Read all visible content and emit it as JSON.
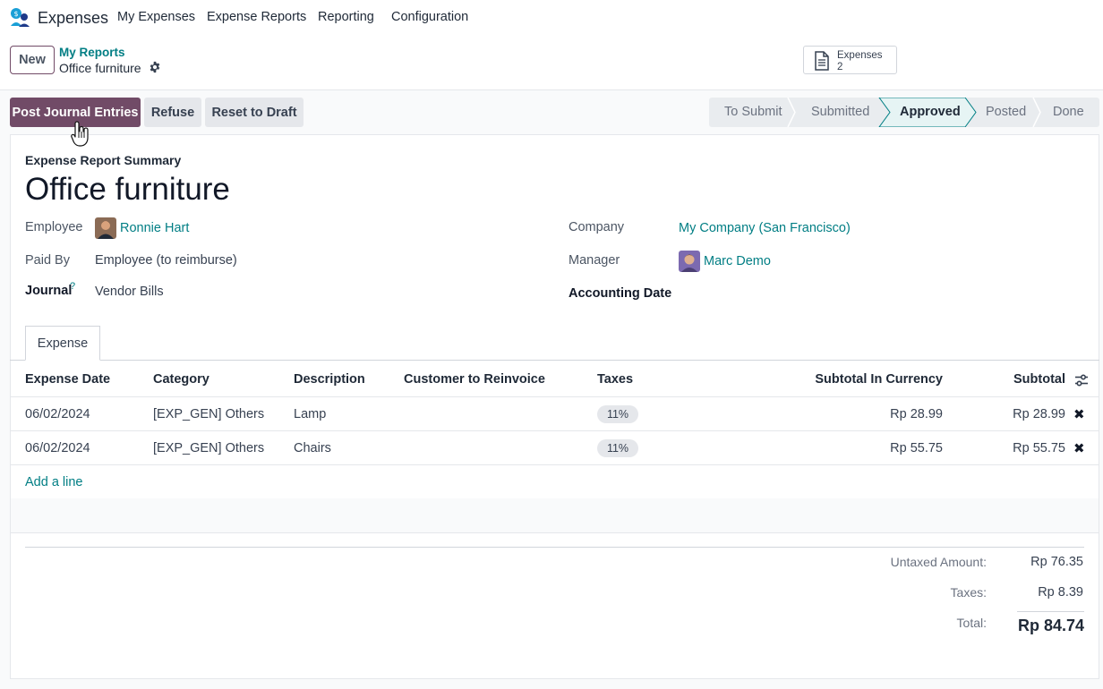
{
  "navbar": {
    "app_name": "Expenses",
    "menus": [
      "My Expenses",
      "Expense Reports",
      "Reporting",
      "Configuration"
    ]
  },
  "control_panel": {
    "new_label": "New",
    "breadcrumb_parent": "My Reports",
    "breadcrumb_current": "Office furniture",
    "stat_button": {
      "label": "Expenses",
      "count": "2"
    }
  },
  "actions": {
    "post": "Post Journal Entries",
    "refuse": "Refuse",
    "reset": "Reset to Draft"
  },
  "statusbar": {
    "stages": [
      "To Submit",
      "Submitted",
      "Approved",
      "Posted",
      "Done"
    ],
    "active": "Approved"
  },
  "form": {
    "subtitle": "Expense Report Summary",
    "title": "Office furniture",
    "employee_label": "Employee",
    "employee_value": "Ronnie Hart",
    "paid_by_label": "Paid By",
    "paid_by_value": "Employee (to reimburse)",
    "journal_label": "Journal",
    "journal_help": "?",
    "journal_value": "Vendor Bills",
    "company_label": "Company",
    "company_value": "My Company (San Francisco)",
    "manager_label": "Manager",
    "manager_value": "Marc Demo",
    "accounting_date_label": "Accounting Date"
  },
  "tabs": [
    "Expense"
  ],
  "table": {
    "headers": [
      "Expense Date",
      "Category",
      "Description",
      "Customer to Reinvoice",
      "Taxes",
      "Subtotal In Currency",
      "Subtotal"
    ],
    "rows": [
      {
        "date": "06/02/2024",
        "category": "[EXP_GEN] Others",
        "description": "Lamp",
        "customer": "",
        "tax": "11%",
        "subtotal_currency": "Rp 28.99",
        "subtotal": "Rp 28.99"
      },
      {
        "date": "06/02/2024",
        "category": "[EXP_GEN] Others",
        "description": "Chairs",
        "customer": "",
        "tax": "11%",
        "subtotal_currency": "Rp 55.75",
        "subtotal": "Rp 55.75"
      }
    ],
    "add_line": "Add a line"
  },
  "totals": {
    "untaxed_label": "Untaxed Amount:",
    "untaxed_value": "Rp 76.35",
    "taxes_label": "Taxes:",
    "taxes_value": "Rp 8.39",
    "total_label": "Total:",
    "total_value": "Rp 84.74"
  },
  "colors": {
    "primary": "#714b67",
    "link": "#017e84",
    "active_stage": "#e6f4f4"
  }
}
